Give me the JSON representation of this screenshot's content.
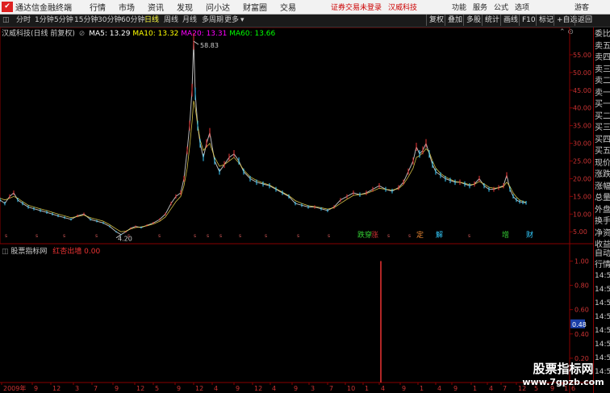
{
  "titlebar": {
    "app_name": "通达信金融终端",
    "menus": [
      "行情",
      "市场",
      "资讯",
      "发现",
      "问小达",
      "财富圈",
      "交易"
    ],
    "login_notice": "证券交易未登录",
    "stock_link": "汉威科技",
    "right_menus": [
      "功能",
      "服务",
      "公式",
      "选项"
    ],
    "user": "游客"
  },
  "toolbar": {
    "periods": [
      "分时",
      "1分钟",
      "5分钟",
      "15分钟",
      "30分钟",
      "60分钟",
      "日线",
      "周线",
      "月线",
      "多周期",
      "更多"
    ],
    "active_period": "日线",
    "more_arrow": "▾",
    "right_buttons": [
      "复权",
      "叠加",
      "多股",
      "统计",
      "画线",
      "F10",
      "标记",
      "+自选",
      "返回"
    ]
  },
  "ma_line": {
    "stock": "汉威科技(日线 前复权)",
    "ma5_label": "MA5: 13.29",
    "ma10_label": "MA10: 13.32",
    "ma20_label": "MA20: 13.31",
    "ma60_label": "MA60: 13.66",
    "colors": {
      "ma5": "#ffffff",
      "ma10": "#ffff00",
      "ma20": "#ff00ff",
      "ma60": "#00ff00"
    }
  },
  "indicator_line": {
    "name": "股票指标网",
    "formula": "红杏出墙",
    "value": "0.00"
  },
  "chart_data": [
    {
      "type": "line",
      "title": "汉威科技(日线 前复权)",
      "yticks": [
        5.0,
        10.0,
        15.0,
        20.0,
        25.0,
        30.0,
        35.0,
        40.0,
        45.0,
        50.0,
        55.0
      ],
      "ylim": [
        3,
        60
      ],
      "max_label": "58.83",
      "min_label": "4.20",
      "x": [
        0,
        6,
        12,
        17,
        22,
        28,
        35,
        42,
        50,
        58,
        65,
        72,
        80,
        88,
        96,
        104,
        112,
        120,
        128,
        136,
        144,
        150,
        156,
        162,
        168,
        175,
        182,
        190,
        198,
        205,
        212,
        218,
        224,
        228,
        232,
        235,
        238,
        240,
        242,
        245,
        248,
        252,
        256,
        260,
        266,
        272,
        278,
        284,
        290,
        296,
        302,
        310,
        318,
        326,
        334,
        342,
        350,
        358,
        366,
        374,
        382,
        390,
        398,
        406,
        414,
        422,
        430,
        438,
        446,
        454,
        462,
        470,
        478,
        486,
        494,
        500,
        506,
        512,
        516,
        520,
        524,
        528,
        532,
        536,
        540,
        546,
        552,
        558,
        564,
        570,
        576,
        582,
        588,
        594,
        600,
        606,
        612,
        618,
        624,
        628,
        632,
        636,
        640,
        644,
        648,
        652
      ],
      "series": [
        {
          "name": "price",
          "values": [
            14,
            13,
            15,
            16,
            14,
            13,
            12,
            11.5,
            11,
            10.5,
            10,
            9.5,
            9,
            8.5,
            9.5,
            10,
            8.5,
            8,
            7.5,
            6.5,
            5,
            4.2,
            5,
            6,
            6.5,
            6.2,
            6.8,
            7.5,
            8.5,
            10,
            13,
            15,
            16,
            20,
            28,
            35,
            45,
            58.83,
            44,
            35,
            30,
            26,
            30,
            33,
            25,
            22,
            24,
            26,
            27,
            25,
            22,
            20,
            19,
            18.5,
            18,
            17,
            16,
            15,
            13,
            12.5,
            12,
            12,
            11.5,
            11,
            12,
            14,
            15,
            16,
            15.5,
            16,
            17,
            18,
            17,
            16.5,
            17.5,
            19,
            22,
            25,
            29,
            27,
            28,
            30,
            27,
            24,
            22,
            21,
            20,
            19.5,
            19,
            19,
            18.5,
            18,
            18.5,
            20,
            18,
            17,
            17,
            17.5,
            18,
            21,
            17,
            15,
            14,
            13.5,
            13.3,
            13.2
          ]
        },
        {
          "name": "MA",
          "values": [
            14.5,
            14,
            14.5,
            15,
            14.5,
            13.5,
            12.5,
            12,
            11.5,
            11,
            10.5,
            10,
            9.5,
            9,
            9.3,
            9.7,
            9,
            8.5,
            8,
            7,
            5.8,
            5,
            5.2,
            5.8,
            6.2,
            6.4,
            6.7,
            7.2,
            8,
            9.2,
            11.5,
            13.5,
            15,
            18,
            23,
            29,
            36,
            42,
            40,
            35,
            31,
            28,
            29,
            30,
            26,
            23.5,
            24,
            25,
            26,
            24.5,
            22.5,
            20.5,
            19.5,
            18.8,
            18.2,
            17.2,
            16.2,
            15.2,
            13.8,
            13,
            12.4,
            12.1,
            11.8,
            11.4,
            11.8,
            13,
            14.2,
            15.3,
            15.5,
            15.8,
            16.5,
            17.3,
            17,
            16.8,
            17.2,
            18.4,
            20.5,
            23,
            26,
            26.5,
            27.3,
            28.5,
            27.5,
            25,
            23,
            21.5,
            20.5,
            19.8,
            19.2,
            19,
            18.7,
            18.3,
            18.4,
            19.2,
            18.5,
            17.6,
            17.3,
            17.4,
            17.8,
            19,
            17.8,
            16,
            14.8,
            14,
            13.6,
            13.3
          ]
        }
      ]
    },
    {
      "type": "bar",
      "title": "红杏出墙",
      "yticks": [
        0.2,
        0.4,
        0.6,
        0.8,
        1.0
      ],
      "ylim": [
        0,
        1.05
      ],
      "current_label": "0.48",
      "bars": [
        {
          "x": 472,
          "value": 1.0
        }
      ]
    }
  ],
  "event_markers": [
    "跌穿",
    "涨",
    "定",
    "解",
    "增",
    "财"
  ],
  "xaxis_labels": [
    "2009年",
    "9",
    "12",
    "3",
    "7",
    "9",
    "12",
    "5",
    "9",
    "12",
    "4",
    "9",
    "12",
    "4",
    "9",
    "3",
    "7",
    "10",
    "1",
    "4",
    "9",
    "1",
    "4",
    "9",
    "1",
    "4",
    "7",
    "12",
    "5",
    "9",
    "1",
    "6"
  ],
  "right_panel": {
    "labels": [
      "委比",
      "卖五",
      "卖四",
      "卖三",
      "卖二",
      "卖一",
      "买一",
      "买二",
      "买三",
      "买四",
      "买五",
      "现价",
      "涨跌",
      "涨幅",
      "总量",
      "外盘",
      "换手",
      "净资",
      "收益"
    ],
    "bottom_labels": [
      "自动",
      "行情"
    ],
    "times": [
      "14:5",
      "14:5",
      "14:5",
      "14:5",
      "14:5",
      "14:5",
      "14:5",
      "14:5"
    ]
  },
  "watermark": {
    "title": "股票指标网",
    "url": "www.7gpzb.com"
  }
}
